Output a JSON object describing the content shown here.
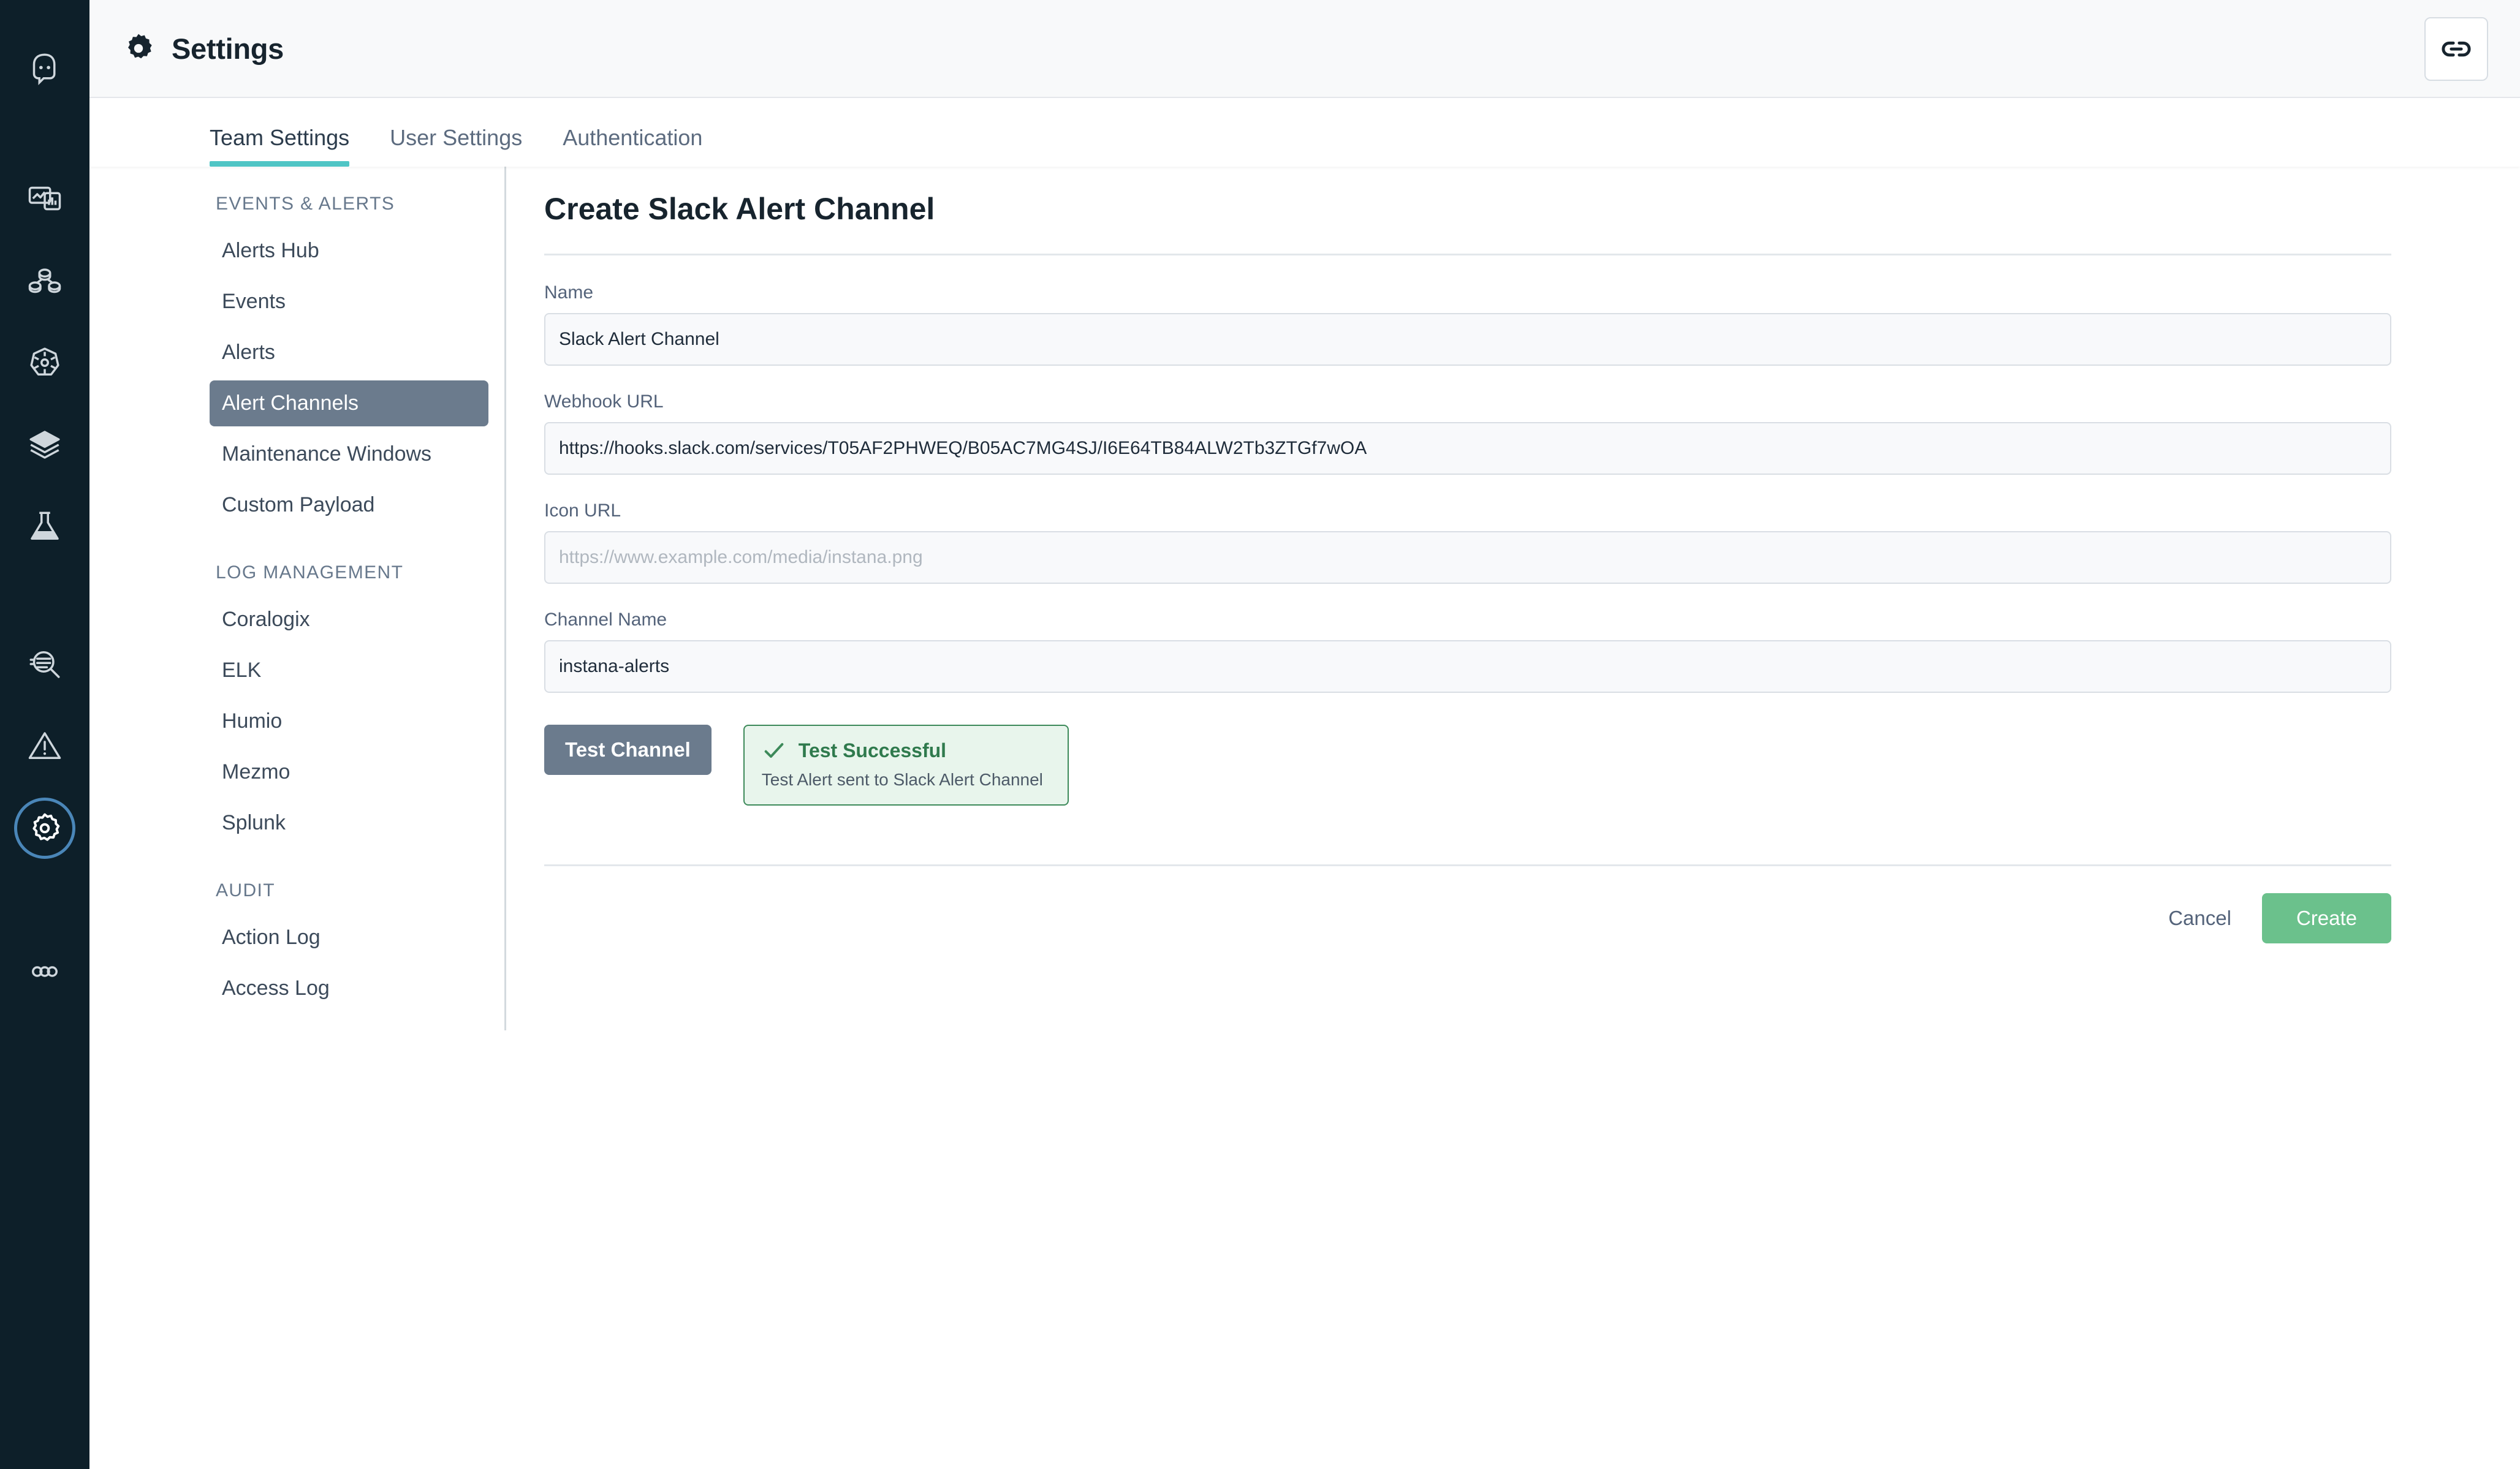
{
  "rail": {
    "logo_icon": "instana-robot-logo-icon",
    "items": [
      {
        "icon": "dashboard-icon",
        "name": "dashboards"
      },
      {
        "icon": "applications-icon",
        "name": "applications"
      },
      {
        "icon": "kubernetes-helm-icon",
        "name": "kubernetes"
      },
      {
        "icon": "stack-layers-icon",
        "name": "infrastructure"
      },
      {
        "icon": "flask-beaker-icon",
        "name": "synthetics"
      },
      {
        "icon": "log-search-icon",
        "name": "analytics"
      },
      {
        "icon": "warning-triangle-icon",
        "name": "events"
      },
      {
        "icon": "gear-icon",
        "name": "settings",
        "active": true
      },
      {
        "icon": "more-dots-icon",
        "name": "more"
      }
    ]
  },
  "header": {
    "title": "Settings",
    "icon": "gear-icon",
    "link_button_icon": "link-chain-icon"
  },
  "tabs": [
    {
      "label": "Team Settings",
      "active": true
    },
    {
      "label": "User Settings",
      "active": false
    },
    {
      "label": "Authentication",
      "active": false
    }
  ],
  "settings_nav": {
    "groups": [
      {
        "title": "EVENTS & ALERTS",
        "items": [
          {
            "label": "Alerts Hub",
            "active": false
          },
          {
            "label": "Events",
            "active": false
          },
          {
            "label": "Alerts",
            "active": false
          },
          {
            "label": "Alert Channels",
            "active": true
          },
          {
            "label": "Maintenance Windows",
            "active": false
          },
          {
            "label": "Custom Payload",
            "active": false
          }
        ]
      },
      {
        "title": "LOG MANAGEMENT",
        "items": [
          {
            "label": "Coralogix",
            "active": false
          },
          {
            "label": "ELK",
            "active": false
          },
          {
            "label": "Humio",
            "active": false
          },
          {
            "label": "Mezmo",
            "active": false
          },
          {
            "label": "Splunk",
            "active": false
          }
        ]
      },
      {
        "title": "AUDIT",
        "items": [
          {
            "label": "Action Log",
            "active": false
          },
          {
            "label": "Access Log",
            "active": false
          }
        ]
      }
    ]
  },
  "form": {
    "title": "Create Slack Alert Channel",
    "name": {
      "label": "Name",
      "value": "Slack Alert Channel",
      "placeholder": ""
    },
    "webhook": {
      "label": "Webhook URL",
      "value": "https://hooks.slack.com/services/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",
      "placeholder": ""
    },
    "icon_url": {
      "label": "Icon URL",
      "value": "",
      "placeholder": "https://www.example.com/media/instana.png"
    },
    "channel_name": {
      "label": "Channel Name",
      "value": "instana-alerts",
      "placeholder": ""
    },
    "test_button": "Test Channel",
    "toast": {
      "icon": "check-icon",
      "title": "Test Successful",
      "message": "Test Alert sent to Slack Alert Channel"
    },
    "cancel_button": "Cancel",
    "create_button": "Create"
  },
  "colors": {
    "rail_background": "#0d1f29",
    "tab_accent": "#4fc5c5",
    "nav_active": "#6b7b8d",
    "create_button": "#6bc18c",
    "toast_border": "#3d8a5a",
    "toast_background": "#e8f5ec",
    "toast_title": "#2f7a4d",
    "focus_ring": "#4a86b8"
  }
}
